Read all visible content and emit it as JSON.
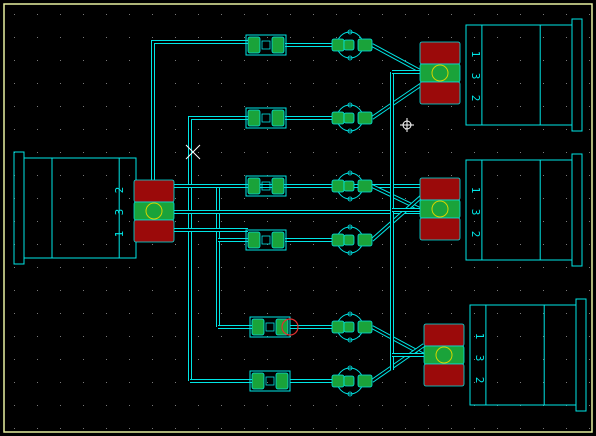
{
  "canvas": {
    "background": "#000000",
    "border_color": "#e8f0a0",
    "grid_color": "#7a7a7a",
    "silk_color": "#00e6e6",
    "trace_color": "#00e6e6",
    "pad_green": "#1aa33a",
    "pad_red": "#9b0a0a",
    "ring_color": "#d4d400",
    "highlight_color": "#e03030",
    "cursor_color": "#ffffff"
  },
  "connectors": [
    {
      "id": "J1",
      "side": "left",
      "pins": [
        "2",
        "3",
        "1"
      ]
    },
    {
      "id": "J2",
      "side": "right",
      "pins": [
        "1",
        "3",
        "2"
      ]
    },
    {
      "id": "J3",
      "side": "right",
      "pins": [
        "1",
        "3",
        "2"
      ]
    },
    {
      "id": "J4",
      "side": "right",
      "pins": [
        "1",
        "3",
        "2"
      ]
    }
  ],
  "resistors": [
    {
      "row": 1,
      "highlighted": false
    },
    {
      "row": 2,
      "highlighted": false
    },
    {
      "row": 3,
      "highlighted": false
    },
    {
      "row": 4,
      "highlighted": false
    },
    {
      "row": 5,
      "highlighted": true
    },
    {
      "row": 6,
      "highlighted": false
    }
  ],
  "transistors": [
    {
      "row": 1
    },
    {
      "row": 2
    },
    {
      "row": 3
    },
    {
      "row": 4
    },
    {
      "row": 5
    },
    {
      "row": 6
    }
  ],
  "markers": [
    {
      "type": "crosshair-cursor"
    },
    {
      "type": "drc-x-marker"
    }
  ]
}
